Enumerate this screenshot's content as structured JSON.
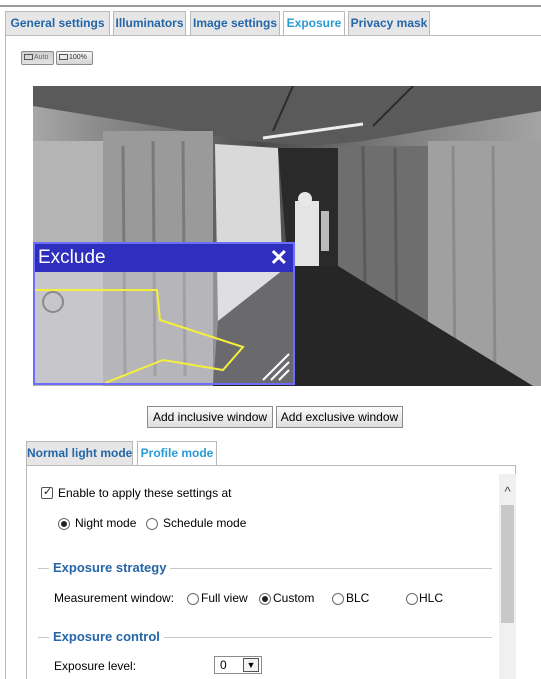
{
  "tabs": [
    {
      "label": "General settings"
    },
    {
      "label": "Illuminators"
    },
    {
      "label": "Image settings"
    },
    {
      "label": "Exposure"
    },
    {
      "label": "Privacy mask"
    }
  ],
  "view_buttons": {
    "auto_label": "Auto",
    "zoom_label": "100%"
  },
  "exclude_window": {
    "title": "Exclude",
    "close_glyph": "✕"
  },
  "window_buttons": {
    "inclusive": "Add inclusive window",
    "exclusive": "Add exclusive window"
  },
  "mode_tabs": [
    {
      "label": "Normal light mode"
    },
    {
      "label": "Profile mode"
    }
  ],
  "profile": {
    "enable_label": "Enable to apply these settings at",
    "enable_checked": true,
    "modes": [
      {
        "label": "Night mode",
        "selected": true
      },
      {
        "label": "Schedule mode",
        "selected": false
      }
    ]
  },
  "exposure_strategy": {
    "title": "Exposure strategy",
    "measurement_label": "Measurement window:",
    "options": [
      {
        "label": "Full view",
        "selected": false
      },
      {
        "label": "Custom",
        "selected": true
      },
      {
        "label": "BLC",
        "selected": false
      },
      {
        "label": "HLC",
        "selected": false
      }
    ]
  },
  "exposure_control": {
    "title": "Exposure control",
    "level_label": "Exposure level:",
    "level_value": "0"
  },
  "icons": {
    "check": "✓",
    "chevron_up": "^",
    "dropdown": "▼"
  }
}
